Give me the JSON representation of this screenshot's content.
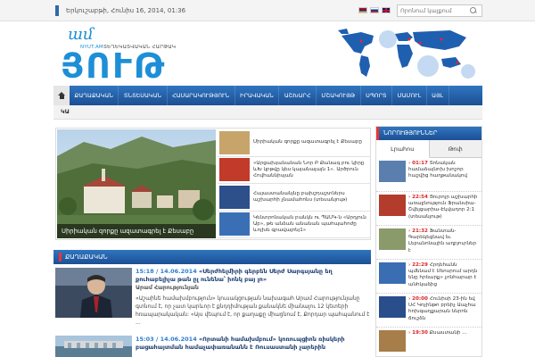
{
  "topbar": {
    "date": "Երկուշաբթի, Հունիս 16, 2014, 01:36",
    "search_placeholder": "Որոնում կայքում",
    "flags": [
      "armenian-flag",
      "russian-flag",
      "english-flag"
    ]
  },
  "header": {
    "logo_small": "ամ",
    "logo_nyut": "NYUT.AM",
    "logo_tagline": "ՏԵՂԵԿԱՏՎԱԿԱՆ ՀԱՐԹԱԿ",
    "logo_main": "ՅՈՒԹ"
  },
  "nav": {
    "items": [
      "ՔԱՂԱՔԱԿԱՆ",
      "ՏՆՏԵՍԱԿԱՆ",
      "ՀԱՍԱՐԱԿՈՒԹՅՈՒՆ",
      "ԻՐԱՎԱԿԱՆ",
      "ԱՇԽԱՐՀ",
      "ՄՇԱԿՈՒՅԹ",
      "ՍՊՈՐՏ",
      "ՄԱՄՈՒԼ",
      "ԱՅԼ"
    ],
    "subnav": "ԿԱ"
  },
  "slider": {
    "caption": "Սիրիական զորքը ազատագրել է Քեսաբը",
    "items": [
      "Սիրիական զորքը ազատագրել է Քեսաբը",
      "«Արցախյանանան Նոր Բ Քանագ բու կիրը ևԽ կրթվը կես կայանալայն 1»․ Արծրուն Հովհաննիսյան",
      "Հայաստանանյնը բախշդաշտներս աշխարհի չնամահոնս (տեսանյութ)",
      "Կենտրոնական բանկն ու ՊԱՄԿ-ն «Արդյուն Աբ», թե անձան անանան պահպահոժը ևոյխե գրավալոնյ1»"
    ],
    "colors": [
      "#c7a56a",
      "#c23a2a",
      "#2d4f8a",
      "#3a6fb6"
    ]
  },
  "section": {
    "title": "ՔԱՂԱՔԱԿԱՆ"
  },
  "articles": [
    {
      "time": "15:18 / 14.06.2014",
      "title": "«Սերժհելմիրի գերբեն Սերժ Սարգսյանը եղ քուհաբելիչա թան ըլ ունենա՝ իոնկ բայ լո»",
      "author": "Արամ Հարությունյան",
      "excerpt": "«Աշաինե համախմբություն» կուսակցության նախագահ Արամ Հարությունյանը գտնում է, որ չատ կարևոր է քնդդիմության քանակնե միանալու 12 կետերի հռապարակական: «Այս վեպում է, որ քաղաքը միացնում է, Քորդար պահպանում է ..."
    },
    {
      "time": "15:03 / 14.06.2014",
      "title": "«Որտանի համախմբում» կոռուպցիոն ռիսկերի բացահայտման համաչափառանանն է Ռուսաստանի չարերին",
      "author": "",
      "excerpt": ""
    }
  ],
  "news": {
    "title": "ՆՈՐՈՒԹՅՈՒՆՆԵՐ",
    "tabs": [
      "Լրահոս",
      "Թոփ"
    ],
    "items": [
      {
        "time": "01:17",
        "text": "Տոնական համաձայնոխ խոշոր հաշվից հաղթանակով"
      },
      {
        "time": "22:54",
        "text": "Յուրոյր աշխարհի առաջնություն Ֆրանսիա-Շվեյցարիա-Էկվադոր 2:1 (տեսանյութ)"
      },
      {
        "time": "21:32",
        "text": "Ֆանտան-Գարեկեցնավ եւ Լեբանոնային աղբյուրներ է"
      },
      {
        "time": "22:29",
        "text": "Հրդեհանն պմենամ է Սեոսրում արդն ենը հրեարք» չոնհարար է անհկաձից"
      },
      {
        "time": "20:00",
        "text": "Հունիսի 23-ին եվ ՍՀ Կոչինթո բրեիչ Աաչհա հոխգադքարան ննրոն ճուշձն"
      },
      {
        "time": "19:30",
        "text": "Քսաստանի ..."
      }
    ],
    "thumb_colors": [
      "#5a7fae",
      "#b33c2c",
      "#8a9a6a",
      "#3b6db3",
      "#2a4d8c",
      "#a77d4a"
    ]
  }
}
